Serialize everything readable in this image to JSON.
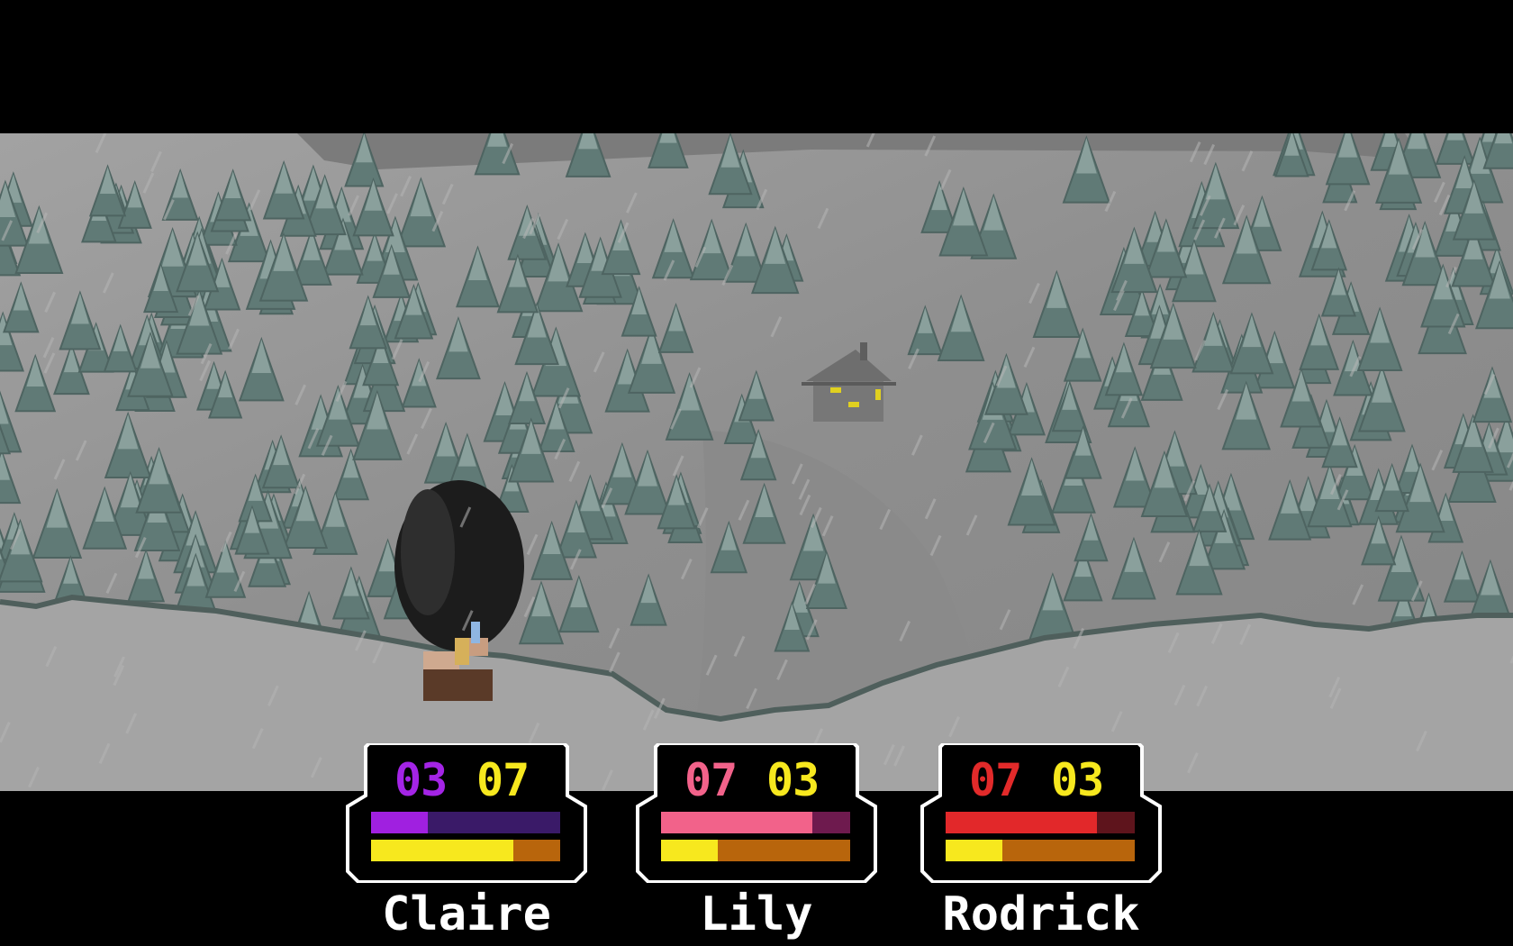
{
  "party": [
    {
      "name": "Claire",
      "hp": "03",
      "mp": "07",
      "hp_fraction": 0.3,
      "mp_fraction": 0.75,
      "hp_color": "#a020e0",
      "hp_track_color": "#3a1a68",
      "mp_color": "#f7e81e",
      "mp_track_color": "#b8650c",
      "hp_text_color": "#a424e6",
      "mp_text_color": "#f7e81e"
    },
    {
      "name": "Lily",
      "hp": "07",
      "mp": "03",
      "hp_fraction": 0.8,
      "mp_fraction": 0.3,
      "hp_color": "#f2628a",
      "hp_track_color": "#6e1a4e",
      "mp_color": "#f7e81e",
      "mp_track_color": "#b8650c",
      "hp_text_color": "#f2628a",
      "mp_text_color": "#f7e81e"
    },
    {
      "name": "Rodrick",
      "hp": "07",
      "mp": "03",
      "hp_fraction": 0.8,
      "mp_fraction": 0.3,
      "hp_color": "#e2282a",
      "hp_track_color": "#5e141c",
      "mp_color": "#f7e81e",
      "mp_track_color": "#b8650c",
      "hp_text_color": "#e22a2a",
      "mp_text_color": "#f7e81e"
    }
  ],
  "scene": {
    "sky_color": "#8f8f8f",
    "snow_color": "#9a9a9a",
    "tree_color": "#607a76",
    "cabin_window_color": "#e0d020"
  }
}
